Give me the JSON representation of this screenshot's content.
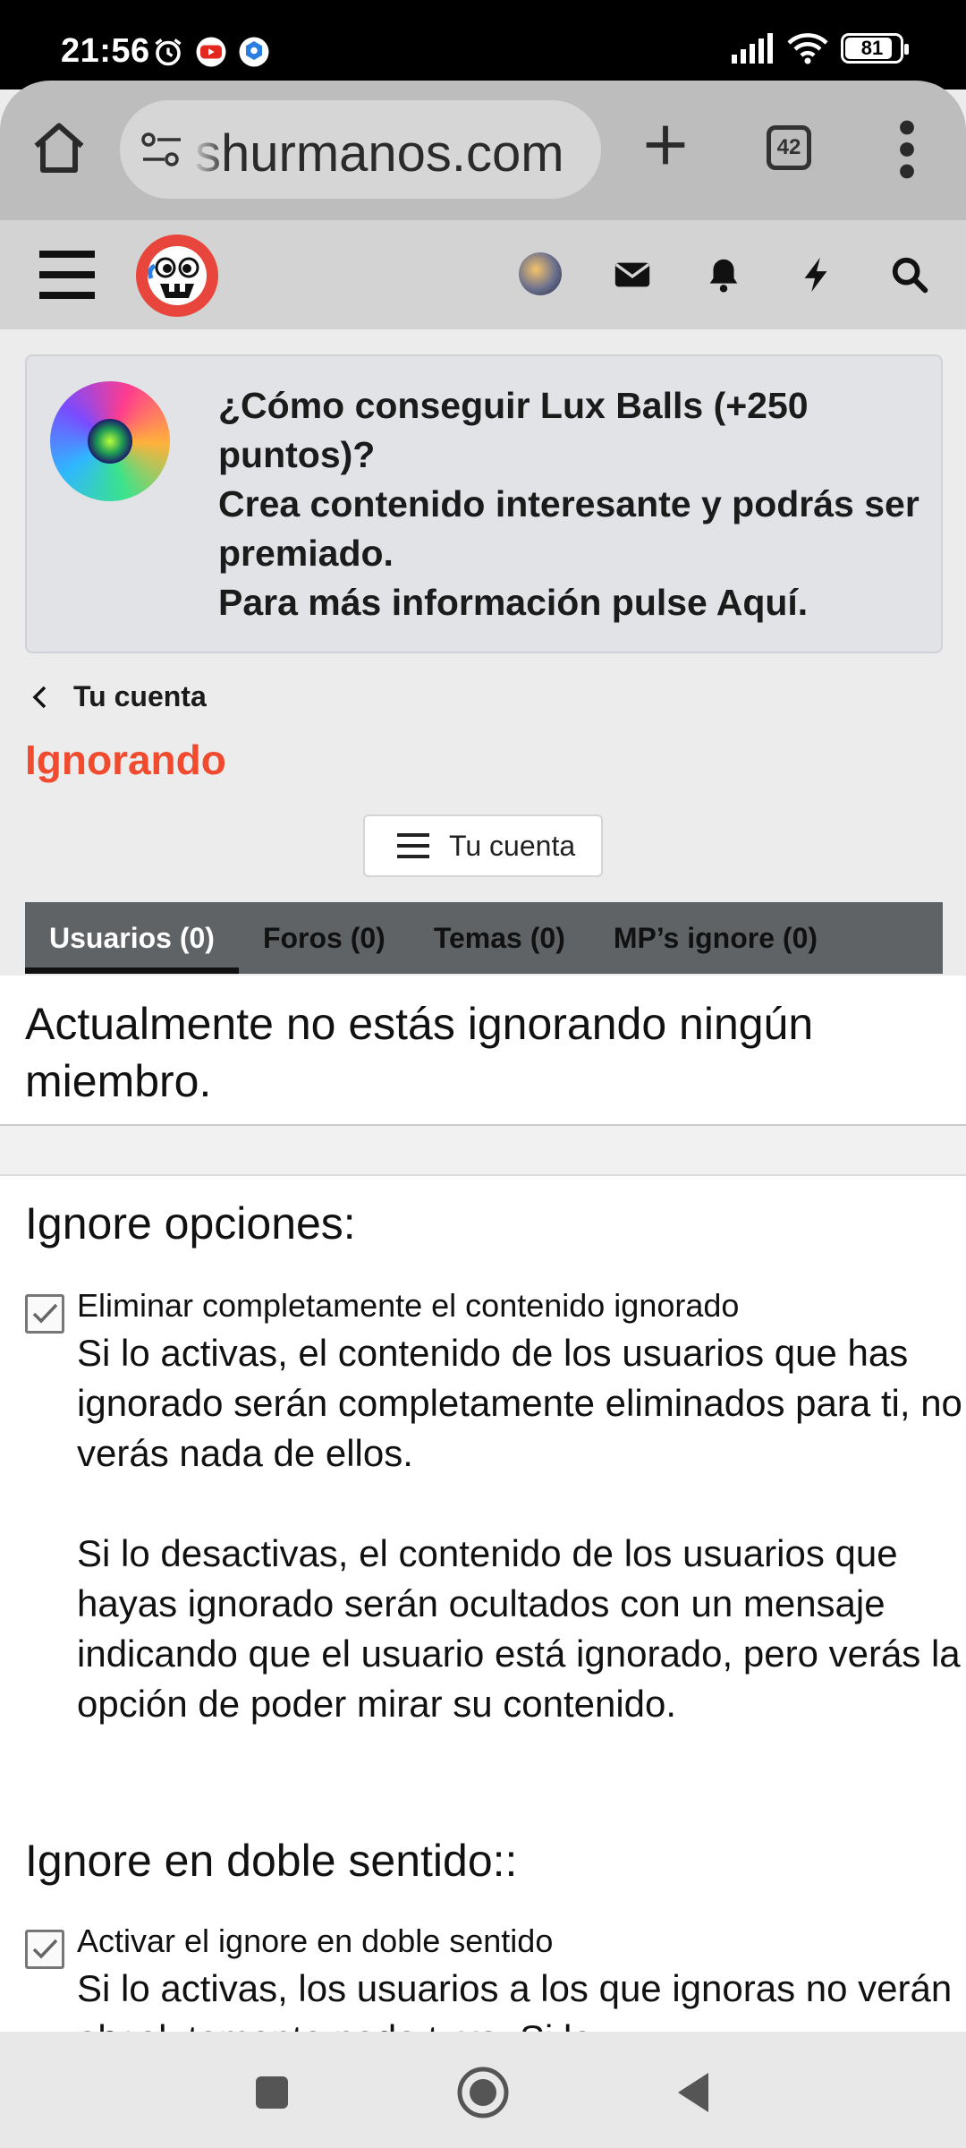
{
  "status_bar": {
    "time": "21:56",
    "battery_level": "81"
  },
  "browser": {
    "url": "shurmanos.com",
    "tab_count": "42"
  },
  "banner": {
    "line1": "¿Cómo conseguir Lux Balls (+250 puntos)?",
    "line2": "Crea contenido interesante y podrás ser premiado.",
    "line3": "Para más información pulse Aquí."
  },
  "breadcrumb": {
    "label": "Tu cuenta"
  },
  "page": {
    "title": "Ignorando",
    "account_button": "Tu cuenta"
  },
  "tabs": [
    {
      "label": "Usuarios (0)",
      "active": true
    },
    {
      "label": "Foros (0)",
      "active": false
    },
    {
      "label": "Temas (0)",
      "active": false
    },
    {
      "label": "MP’s ignore (0)",
      "active": false
    }
  ],
  "content": {
    "empty_message": "Actualmente no estás ignorando ningún miembro.",
    "section1_title": "Ignore opciones:",
    "option1": {
      "label": "Eliminar completamente el contenido ignorado",
      "checked": true,
      "desc1": "Si lo activas, el contenido de los usuarios que has ignorado serán completamente eliminados para ti, no verás nada de ellos.",
      "desc2": "Si lo desactivas, el contenido de los usuarios que hayas ignorado serán ocultados con un mensaje indicando que el usuario está ignorado, pero verás la opción de poder mirar su contenido."
    },
    "section2_title": "Ignore en doble sentido::",
    "option2": {
      "label": "Activar el ignore en doble sentido",
      "checked": true,
      "desc1": "Si lo activas, los usuarios a los que ignoras no verán absolutamente nada tuyo. Si lo"
    }
  },
  "colors": {
    "accent": "#f04a2f",
    "tab_bar": "#5f6366",
    "header": "#d3d3d3"
  }
}
